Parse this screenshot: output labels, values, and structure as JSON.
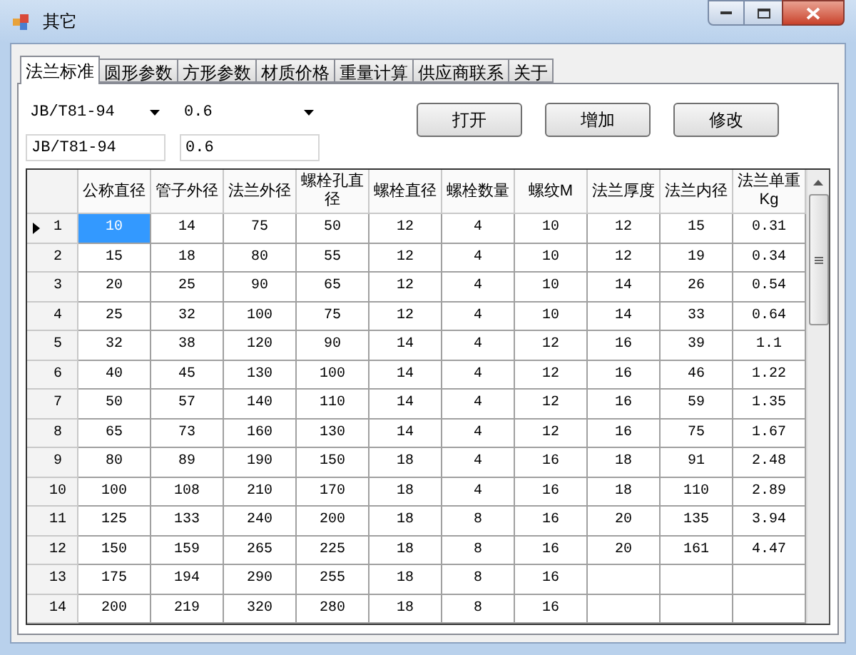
{
  "window": {
    "title": "其它"
  },
  "tabs": [
    {
      "label": "法兰标准",
      "selected": true
    },
    {
      "label": "圆形参数",
      "selected": false
    },
    {
      "label": "方形参数",
      "selected": false
    },
    {
      "label": "材质价格",
      "selected": false
    },
    {
      "label": "重量计算",
      "selected": false
    },
    {
      "label": "供应商联系",
      "selected": false
    },
    {
      "label": "关于",
      "selected": false
    }
  ],
  "dropdowns": [
    {
      "value": "JB/T81-94"
    },
    {
      "value": "0.6"
    }
  ],
  "text_fields": [
    {
      "value": "JB/T81-94"
    },
    {
      "value": "0.6"
    }
  ],
  "buttons": [
    "打开",
    "增加",
    "修改"
  ],
  "table": {
    "columns": [
      "公称直径",
      "管子外径",
      "法兰外径",
      "螺栓孔直径",
      "螺栓直径",
      "螺栓数量",
      "螺纹M",
      "法兰厚度",
      "法兰内径",
      "法兰单重Kg"
    ],
    "rows": [
      {
        "number": "1",
        "current": true,
        "cells": [
          "10",
          "14",
          "75",
          "50",
          "12",
          "4",
          "10",
          "12",
          "15",
          "0.31"
        ]
      },
      {
        "number": "2",
        "current": false,
        "cells": [
          "15",
          "18",
          "80",
          "55",
          "12",
          "4",
          "10",
          "12",
          "19",
          "0.34"
        ]
      },
      {
        "number": "3",
        "current": false,
        "cells": [
          "20",
          "25",
          "90",
          "65",
          "12",
          "4",
          "10",
          "14",
          "26",
          "0.54"
        ]
      },
      {
        "number": "4",
        "current": false,
        "cells": [
          "25",
          "32",
          "100",
          "75",
          "12",
          "4",
          "10",
          "14",
          "33",
          "0.64"
        ]
      },
      {
        "number": "5",
        "current": false,
        "cells": [
          "32",
          "38",
          "120",
          "90",
          "14",
          "4",
          "12",
          "16",
          "39",
          "1.1"
        ]
      },
      {
        "number": "6",
        "current": false,
        "cells": [
          "40",
          "45",
          "130",
          "100",
          "14",
          "4",
          "12",
          "16",
          "46",
          "1.22"
        ]
      },
      {
        "number": "7",
        "current": false,
        "cells": [
          "50",
          "57",
          "140",
          "110",
          "14",
          "4",
          "12",
          "16",
          "59",
          "1.35"
        ]
      },
      {
        "number": "8",
        "current": false,
        "cells": [
          "65",
          "73",
          "160",
          "130",
          "14",
          "4",
          "12",
          "16",
          "75",
          "1.67"
        ]
      },
      {
        "number": "9",
        "current": false,
        "cells": [
          "80",
          "89",
          "190",
          "150",
          "18",
          "4",
          "16",
          "18",
          "91",
          "2.48"
        ]
      },
      {
        "number": "10",
        "current": false,
        "cells": [
          "100",
          "108",
          "210",
          "170",
          "18",
          "4",
          "16",
          "18",
          "110",
          "2.89"
        ]
      },
      {
        "number": "11",
        "current": false,
        "cells": [
          "125",
          "133",
          "240",
          "200",
          "18",
          "8",
          "16",
          "20",
          "135",
          "3.94"
        ]
      },
      {
        "number": "12",
        "current": false,
        "cells": [
          "150",
          "159",
          "265",
          "225",
          "18",
          "8",
          "16",
          "20",
          "161",
          "4.47"
        ]
      },
      {
        "number": "13",
        "current": false,
        "cells": [
          "175",
          "194",
          "290",
          "255",
          "18",
          "8",
          "16"
        ]
      },
      {
        "number": "14",
        "current": false,
        "cells": [
          "200",
          "219",
          "320",
          "280",
          "18",
          "8",
          "16"
        ]
      }
    ]
  }
}
